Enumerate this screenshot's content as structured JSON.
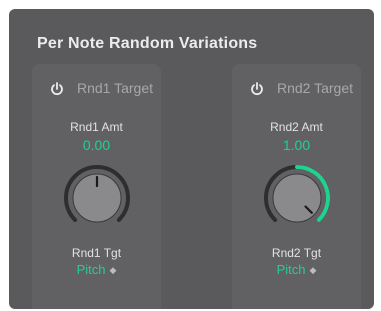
{
  "title": "Per Note Random Variations",
  "colors": {
    "background": "#5a5a5c",
    "panel": "#616163",
    "accent": "#1fd28f",
    "track": "#2e2e30"
  },
  "panels": [
    {
      "header": "Rnd1 Target",
      "power_icon": "power-icon",
      "amount_label": "Rnd1 Amt",
      "amount_value": "0.00",
      "amount": 0.0,
      "target_label": "Rnd1 Tgt",
      "target_value": "Pitch",
      "target_chevron_icon": "chevron-updown-icon"
    },
    {
      "header": "Rnd2 Target",
      "power_icon": "power-icon",
      "amount_label": "Rnd2 Amt",
      "amount_value": "1.00",
      "amount": 1.0,
      "target_label": "Rnd2 Tgt",
      "target_value": "Pitch",
      "target_chevron_icon": "chevron-updown-icon"
    }
  ]
}
